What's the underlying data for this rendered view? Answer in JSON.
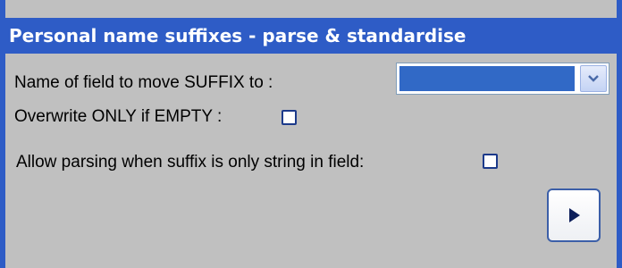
{
  "window": {
    "title": "Personal name suffixes - parse & standardise"
  },
  "form": {
    "field_label": "Name of field to move SUFFIX to :",
    "field_select": {
      "selected_value": "",
      "icon": "chevron-down-icon"
    },
    "overwrite_label": "Overwrite ONLY if EMPTY :",
    "overwrite_checked": false,
    "allow_label": "Allow parsing when suffix is only string in field:",
    "allow_checked": false
  },
  "actions": {
    "run_icon": "play-icon"
  },
  "colors": {
    "title_bar": "#2e5cc6",
    "panel_background": "#c0c0c0",
    "selection_highlight": "#3169c6",
    "checkbox_border": "#1c3a8a"
  }
}
